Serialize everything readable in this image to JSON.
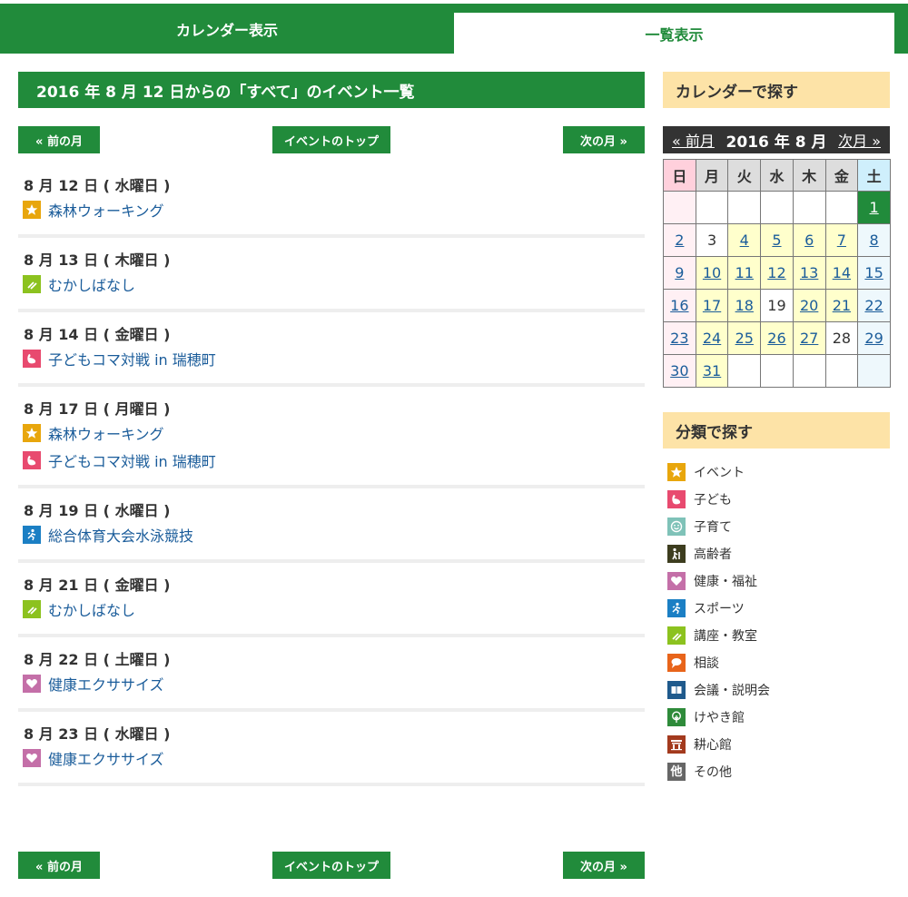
{
  "tabs": {
    "calendar": "カレンダー表示",
    "list": "一覧表示"
  },
  "list_title": "2016 年 8 月 12 日からの「すべて」のイベント一覧",
  "nav": {
    "prev": "« 前の月",
    "top": "イベントのトップ",
    "next": "次の月 »"
  },
  "days": [
    {
      "date": "8 月 12 日 ( 水曜日 )",
      "events": [
        {
          "icon": "star-icon",
          "color": "#e8a60c",
          "title": "森林ウォーキング"
        }
      ]
    },
    {
      "date": "8 月 13 日 ( 木曜日 )",
      "events": [
        {
          "icon": "pencil-icon",
          "color": "#8cc21f",
          "title": "むかしばなし"
        }
      ]
    },
    {
      "date": "8 月 14 日 ( 金曜日 )",
      "events": [
        {
          "icon": "child-icon",
          "color": "#e84a6f",
          "title": "子どもコマ対戦 in 瑞穂町"
        }
      ]
    },
    {
      "date": "8 月 17 日 ( 月曜日 )",
      "events": [
        {
          "icon": "star-icon",
          "color": "#e8a60c",
          "title": "森林ウォーキング"
        },
        {
          "icon": "child-icon",
          "color": "#e84a6f",
          "title": "子どもコマ対戦 in 瑞穂町"
        }
      ]
    },
    {
      "date": "8 月 19 日 ( 水曜日 )",
      "events": [
        {
          "icon": "sports-icon",
          "color": "#1b7fc4",
          "title": "総合体育大会水泳競技"
        }
      ]
    },
    {
      "date": "8 月 21 日 ( 金曜日 )",
      "events": [
        {
          "icon": "pencil-icon",
          "color": "#8cc21f",
          "title": "むかしばなし"
        }
      ]
    },
    {
      "date": "8 月 22 日 ( 土曜日 )",
      "events": [
        {
          "icon": "heart-icon",
          "color": "#c46fa8",
          "title": "健康エクササイズ"
        }
      ]
    },
    {
      "date": "8 月 23 日 ( 水曜日 )",
      "events": [
        {
          "icon": "heart-icon",
          "color": "#c46fa8",
          "title": "健康エクササイズ"
        }
      ]
    }
  ],
  "sidebar": {
    "calendar_heading": "カレンダーで探す",
    "calendar": {
      "prev": "« 前月",
      "year_month": "2016 年 8 月",
      "next": "次月 »",
      "weekdays": [
        "日",
        "月",
        "火",
        "水",
        "木",
        "金",
        "土"
      ],
      "weeks": [
        [
          "",
          "",
          "",
          "",
          "",
          "",
          "1"
        ],
        [
          "2",
          "3",
          "4",
          "5",
          "6",
          "7",
          "8"
        ],
        [
          "9",
          "10",
          "11",
          "12",
          "13",
          "14",
          "15"
        ],
        [
          "16",
          "17",
          "18",
          "19",
          "20",
          "21",
          "22"
        ],
        [
          "23",
          "24",
          "25",
          "26",
          "27",
          "28",
          "29"
        ],
        [
          "30",
          "31",
          "",
          "",
          "",
          "",
          ""
        ]
      ],
      "plain_days": [
        "3",
        "19",
        "28"
      ],
      "highlight_days": [
        "4",
        "5",
        "6",
        "7",
        "10",
        "11",
        "12",
        "13",
        "14",
        "17",
        "18",
        "20",
        "21",
        "24",
        "25",
        "26",
        "27",
        "31"
      ],
      "today": "1"
    },
    "category_heading": "分類で探す",
    "categories": [
      {
        "label": "イベント",
        "icon": "star-icon",
        "color": "#e8a60c"
      },
      {
        "label": "子ども",
        "icon": "child-icon",
        "color": "#e84a6f"
      },
      {
        "label": "子育て",
        "icon": "smile-icon",
        "color": "#7fc2b8"
      },
      {
        "label": "高齢者",
        "icon": "elder-icon",
        "color": "#3d3d1f"
      },
      {
        "label": "健康・福祉",
        "icon": "heart-icon",
        "color": "#c46fa8"
      },
      {
        "label": "スポーツ",
        "icon": "sports-icon",
        "color": "#1b7fc4"
      },
      {
        "label": "講座・教室",
        "icon": "pencil-icon",
        "color": "#8cc21f"
      },
      {
        "label": "相談",
        "icon": "speech-icon",
        "color": "#e8641a"
      },
      {
        "label": "会議・説明会",
        "icon": "book-icon",
        "color": "#1f5a8c"
      },
      {
        "label": "けやき館",
        "icon": "tree-icon",
        "color": "#2e8b3a"
      },
      {
        "label": "耕心館",
        "icon": "house-icon",
        "color": "#a33a1e"
      },
      {
        "label": "その他",
        "icon": "other-icon",
        "color": "#666666",
        "glyph": "他"
      }
    ]
  }
}
